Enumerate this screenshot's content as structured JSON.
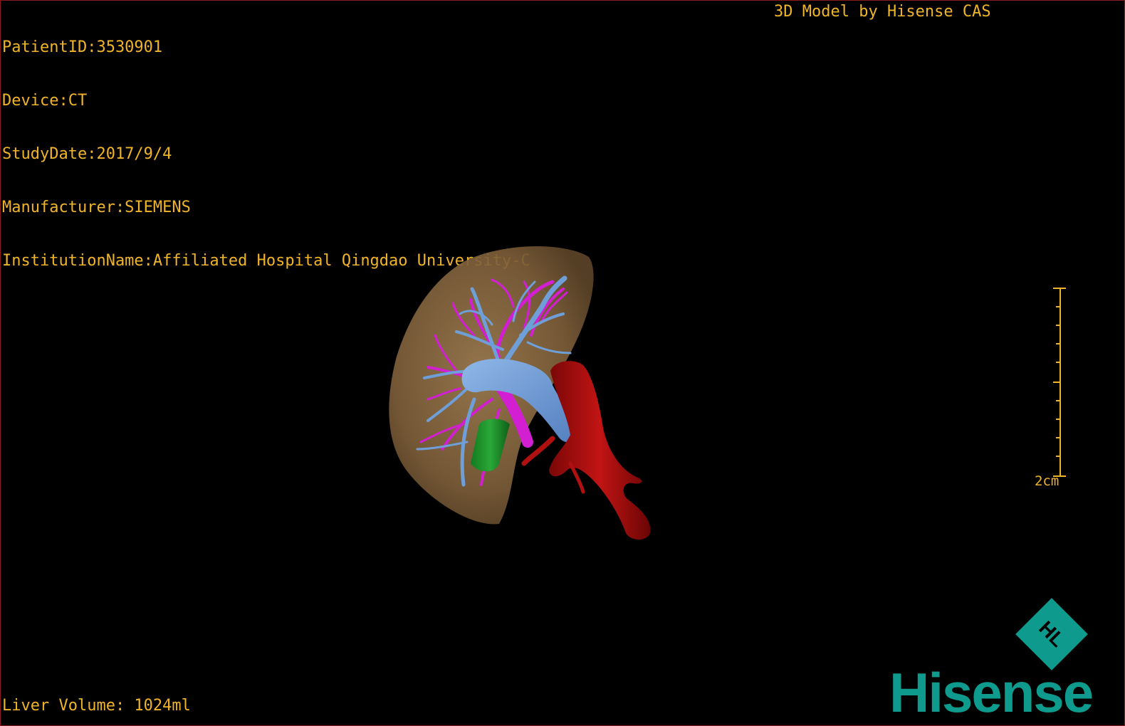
{
  "dicom_info": {
    "patient_id": "PatientID:3530901",
    "device": "Device:CT",
    "study_date": "StudyDate:2017/9/4",
    "manufacturer": "Manufacturer:SIEMENS",
    "institution": "InstitutionName:Affiliated Hospital Qingdao University-C"
  },
  "brand_caption": "3D Model by Hisense CAS",
  "liver_volume": "Liver Volume: 1024ml",
  "scale_bar": {
    "label": "2cm"
  },
  "logo": {
    "wordmark": "Hisense",
    "emblem_text": "HL",
    "color": "#0e9a8c"
  },
  "colors": {
    "overlay_text": "#f0b429",
    "liver_parenchyma": "#8a6a43",
    "portal_vein": "#6f9fd8",
    "hepatic_artery": "#d21fd2",
    "inferior_vena_cava": "#b01010",
    "gallbladder": "#1f8f2a",
    "background": "#000000"
  }
}
